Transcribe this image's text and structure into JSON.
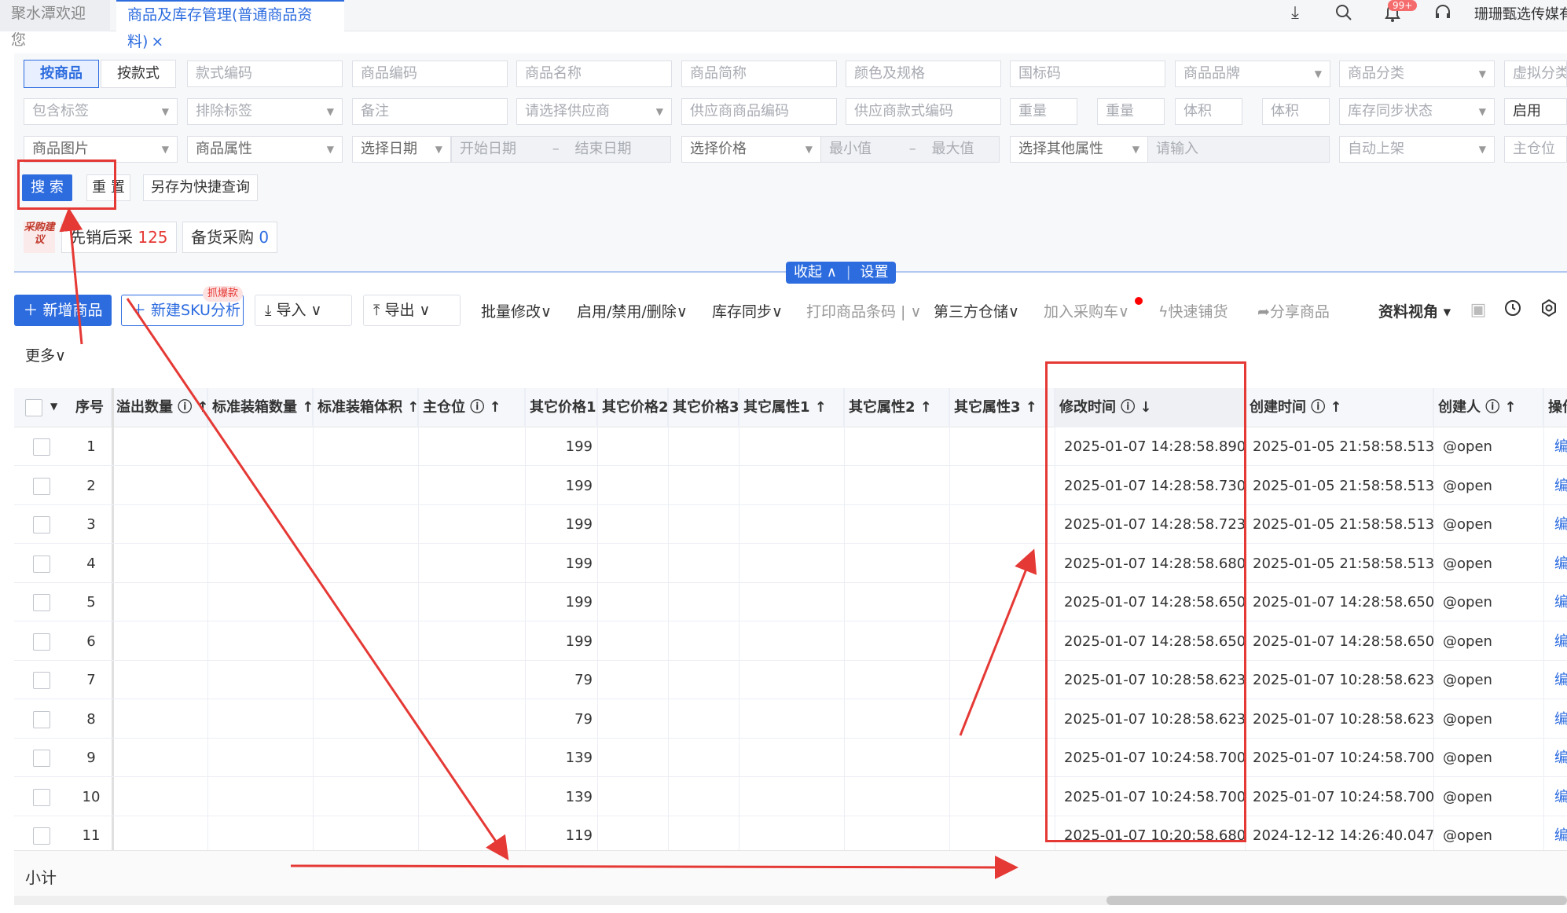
{
  "tabs": {
    "welcome": "聚水潭欢迎您",
    "active": "商品及库存管理(普通商品资料)",
    "close": "×"
  },
  "header": {
    "notify_badge": "99+",
    "username": "珊珊甄选传媒有"
  },
  "filters": {
    "mode_product": "按商品",
    "mode_style": "按款式",
    "row1": [
      "款式编码",
      "商品编码",
      "商品名称",
      "商品简称",
      "颜色及规格",
      "国标码",
      "商品品牌",
      "商品分类",
      "虚拟分类"
    ],
    "row2": [
      "包含标签",
      "排除标签",
      "备注",
      "请选择供应商",
      "供应商商品编码",
      "供应商款式编码",
      "重量",
      "重量",
      "体积",
      "体积",
      "库存同步状态",
      "启用"
    ],
    "row3": [
      "商品图片",
      "商品属性",
      "选择日期",
      "开始日期",
      "–",
      "结束日期",
      "选择价格",
      "最小值",
      "–",
      "最大值",
      "选择其他属性",
      "请输入",
      "自动上架",
      "主仓位"
    ],
    "search": "搜 索",
    "reset": "重 置",
    "save_query": "另存为快捷查询"
  },
  "suggest": {
    "icon": "采购建议",
    "sell_first_label": "先销后采",
    "sell_first_count": "125",
    "stock_label": "备货采购",
    "stock_count": "0"
  },
  "collapse": {
    "collapse": "收起 ∧",
    "settings": "设置"
  },
  "toolbar": {
    "add_product": "＋ 新增商品",
    "new_sku": "＋ 新建SKU分析",
    "hot_badge": "抓爆款",
    "import": "导入",
    "export": "导出",
    "batch_edit": "批量修改",
    "enable_disable": "启用/禁用/删除",
    "stock_sync": "库存同步",
    "print_barcode": "打印商品条码",
    "third_party": "第三方仓储",
    "add_cart": "加入采购车",
    "quick_list": "快速铺货",
    "share": "分享商品",
    "view": "资料视角",
    "more": "更多"
  },
  "table": {
    "columns": [
      "序号",
      "溢出数量",
      "标准装箱数量",
      "标准装箱体积",
      "主仓位",
      "其它价格1",
      "其它价格2",
      "其它价格3",
      "其它属性1",
      "其它属性2",
      "其它属性3",
      "修改时间",
      "创建时间",
      "创建人",
      "操作"
    ],
    "rows": [
      {
        "no": "1",
        "price1": "199",
        "modified": "2025-01-07 14:28:58.890",
        "created": "2025-01-05 21:58:58.513",
        "creator": "@open",
        "op": "编"
      },
      {
        "no": "2",
        "price1": "199",
        "modified": "2025-01-07 14:28:58.730",
        "created": "2025-01-05 21:58:58.513",
        "creator": "@open",
        "op": "编"
      },
      {
        "no": "3",
        "price1": "199",
        "modified": "2025-01-07 14:28:58.723",
        "created": "2025-01-05 21:58:58.513",
        "creator": "@open",
        "op": "编"
      },
      {
        "no": "4",
        "price1": "199",
        "modified": "2025-01-07 14:28:58.680",
        "created": "2025-01-05 21:58:58.513",
        "creator": "@open",
        "op": "编"
      },
      {
        "no": "5",
        "price1": "199",
        "modified": "2025-01-07 14:28:58.650",
        "created": "2025-01-07 14:28:58.650",
        "creator": "@open",
        "op": "编"
      },
      {
        "no": "6",
        "price1": "199",
        "modified": "2025-01-07 14:28:58.650",
        "created": "2025-01-07 14:28:58.650",
        "creator": "@open",
        "op": "编"
      },
      {
        "no": "7",
        "price1": "79",
        "modified": "2025-01-07 10:28:58.623",
        "created": "2025-01-07 10:28:58.623",
        "creator": "@open",
        "op": "编"
      },
      {
        "no": "8",
        "price1": "79",
        "modified": "2025-01-07 10:28:58.623",
        "created": "2025-01-07 10:28:58.623",
        "creator": "@open",
        "op": "编"
      },
      {
        "no": "9",
        "price1": "139",
        "modified": "2025-01-07 10:24:58.700",
        "created": "2025-01-07 10:24:58.700",
        "creator": "@open",
        "op": "编"
      },
      {
        "no": "10",
        "price1": "139",
        "modified": "2025-01-07 10:24:58.700",
        "created": "2025-01-07 10:24:58.700",
        "creator": "@open",
        "op": "编"
      },
      {
        "no": "11",
        "price1": "119",
        "modified": "2025-01-07 10:20:58.680",
        "created": "2024-12-12 14:26:40.047",
        "creator": "@open",
        "op": "编"
      }
    ],
    "subtotal": "小计"
  },
  "colors": {
    "accent": "#2d6cdf",
    "annotation": "#e53935"
  }
}
